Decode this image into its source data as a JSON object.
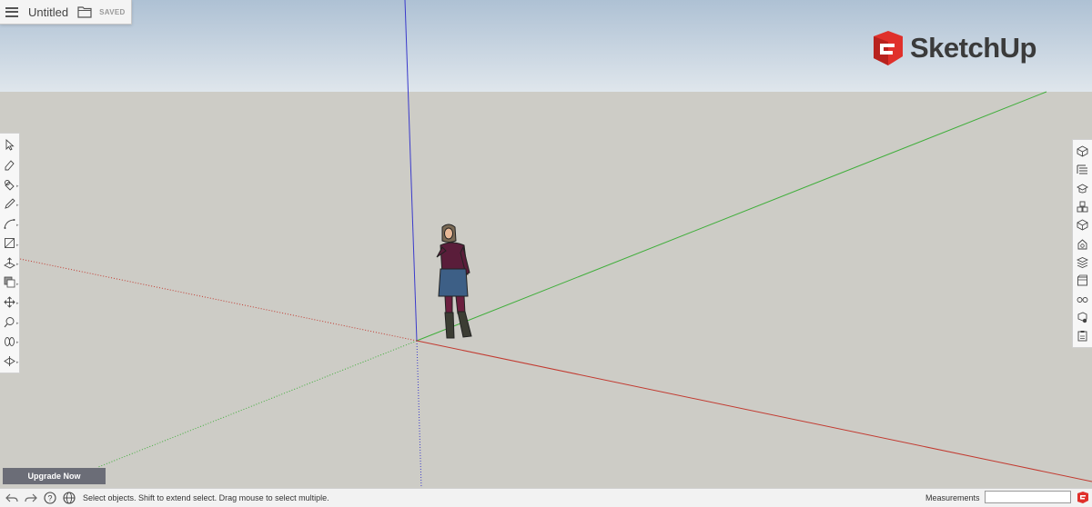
{
  "file": {
    "title": "Untitled",
    "status": "SAVED"
  },
  "brand": {
    "name": "SketchUp",
    "accent_color": "#e0302b"
  },
  "left_toolbar": {
    "tools": [
      {
        "name": "select-tool-icon",
        "has_more": false
      },
      {
        "name": "eraser-tool-icon",
        "has_more": false
      },
      {
        "name": "paint-bucket-tool-icon",
        "has_more": true
      },
      {
        "name": "pencil-tool-icon",
        "has_more": true
      },
      {
        "name": "arc-tool-icon",
        "has_more": true
      },
      {
        "name": "rectangle-tool-icon",
        "has_more": true
      },
      {
        "name": "push-pull-tool-icon",
        "has_more": true
      },
      {
        "name": "offset-tool-icon",
        "has_more": true
      },
      {
        "name": "move-tool-icon",
        "has_more": true
      },
      {
        "name": "tape-measure-tool-icon",
        "has_more": true
      },
      {
        "name": "orbit-tool-icon",
        "has_more": true
      },
      {
        "name": "section-plane-tool-icon",
        "has_more": true
      }
    ]
  },
  "right_toolbar": {
    "panels": [
      "entity-info-icon",
      "outliner-icon",
      "instructor-icon",
      "components-icon",
      "materials-icon",
      "styles-icon",
      "layers-icon",
      "scenes-icon",
      "display-icon",
      "solid-inspector-icon",
      "model-info-icon"
    ]
  },
  "upgrade": {
    "label": "Upgrade Now"
  },
  "status_bar": {
    "hint": "Select objects. Shift to extend select. Drag mouse to select multiple.",
    "measurements_label": "Measurements",
    "measurements_value": ""
  },
  "axes": {
    "red_color": "#c23a30",
    "green_color": "#3fae3a",
    "blue_color": "#3a3acb"
  }
}
